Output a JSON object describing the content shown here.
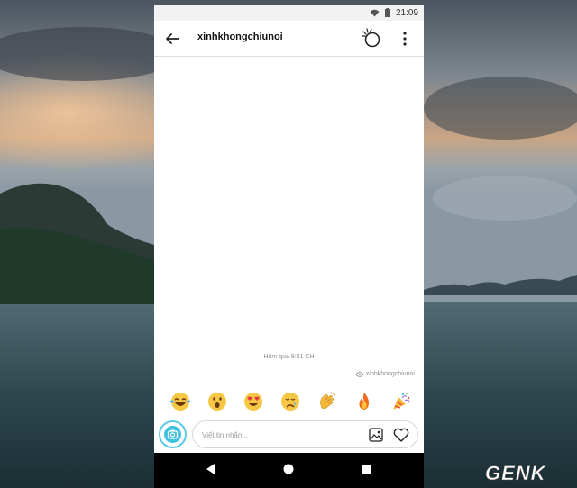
{
  "status_bar": {
    "time": "21:09",
    "icons": [
      "wifi-icon",
      "battery-icon"
    ]
  },
  "header": {
    "username": "xinhkhongchiunoi",
    "icons": [
      "back-arrow-icon",
      "nudge-icon",
      "more-options-icon"
    ]
  },
  "chat": {
    "timestamp": "Hôm qua 9:51 CH",
    "seen_by": "xinhkhongchiunoi"
  },
  "emoji_bar": {
    "items": [
      "face-with-tears-of-joy",
      "face-with-open-mouth",
      "smiling-face-with-heart-eyes",
      "crying-face",
      "clapping-hands",
      "fire",
      "party-popper"
    ]
  },
  "composer": {
    "placeholder": "Viết tin nhắn...",
    "value": "",
    "icons": [
      "camera-icon",
      "gallery-icon",
      "heart-icon"
    ]
  },
  "nav_bar": {
    "icons": [
      "back-triangle-icon",
      "home-circle-icon",
      "recents-square-icon"
    ]
  },
  "watermark": {
    "text": "GENK"
  },
  "colors": {
    "accent": "#3ec1e0",
    "background_sky": "#6f7f8c",
    "water": "#25434a"
  }
}
